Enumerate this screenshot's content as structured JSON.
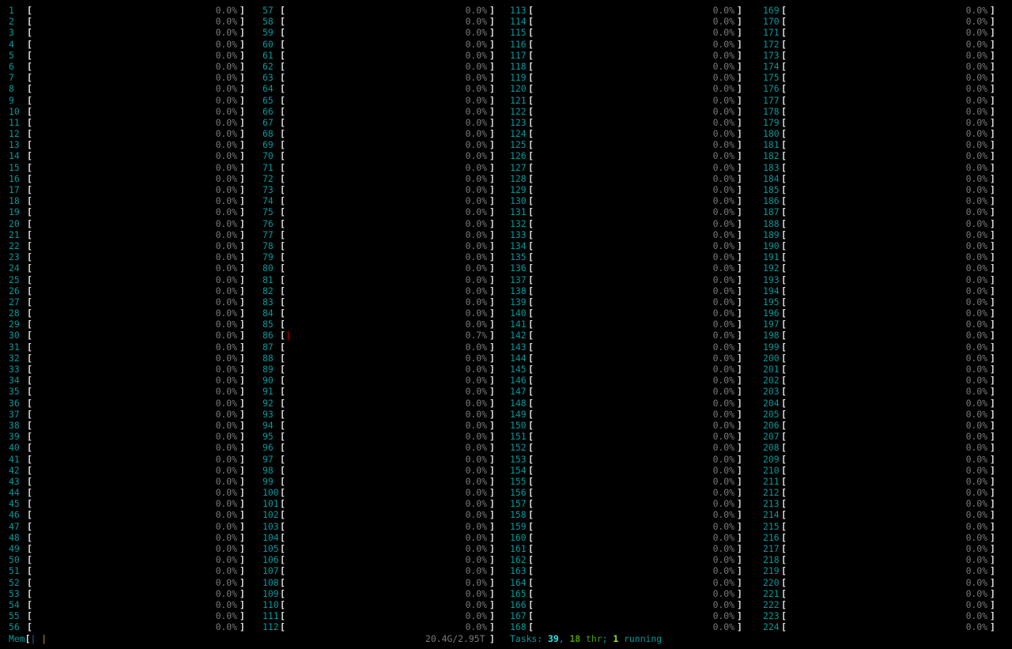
{
  "meters": {
    "cpu_columns": [
      {
        "first": 1,
        "last": 56
      },
      {
        "first": 57,
        "last": 112
      },
      {
        "first": 113,
        "last": 168
      },
      {
        "first": 169,
        "last": 224
      }
    ],
    "default_percent": "0.0%",
    "open_bracket": "[",
    "close_bracket": "]",
    "active_cpus": [
      {
        "cpu": 86,
        "percent": "0.7%",
        "bar": "|"
      }
    ],
    "colors": {
      "cpu_number": "#06989a",
      "bracket": "#e0e0e0",
      "percent_text": "#7a7a7a",
      "bar_kernel": "#cc0000"
    }
  },
  "memory": {
    "label": "Mem",
    "open_bracket": "[",
    "bar_used": "|",
    "bar_cache": "|",
    "value": "20.4G/2.95T",
    "close_bracket": "]"
  },
  "tasks": {
    "label": "Tasks: ",
    "count": "39",
    "sep1": ", ",
    "threads": "18",
    "threads_label": " thr",
    "sep2": "; ",
    "running": "1",
    "running_label": " running"
  }
}
